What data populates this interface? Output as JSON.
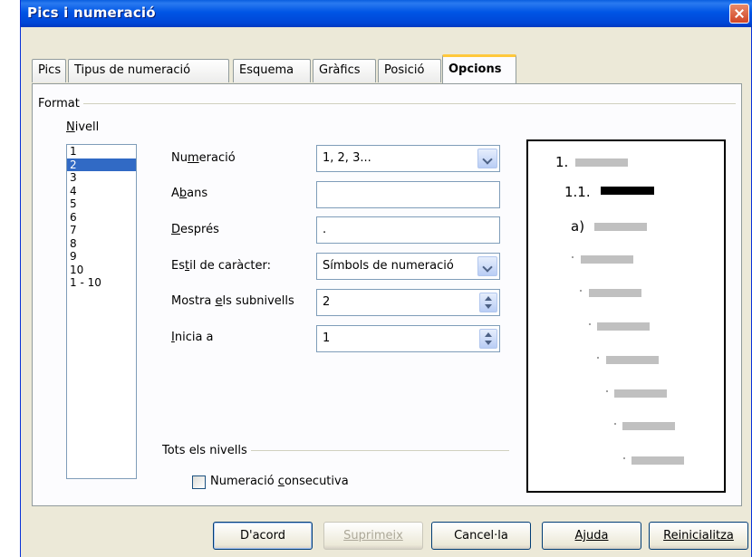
{
  "window": {
    "title": "Pics i numeració"
  },
  "tabs": [
    {
      "label": "Pics"
    },
    {
      "label": "Tipus de numeració"
    },
    {
      "label": "Esquema"
    },
    {
      "label": "Gràfics"
    },
    {
      "label": "Posició"
    },
    {
      "label": "Opcions"
    }
  ],
  "format": {
    "group_label": "Format",
    "level_label_u": "N",
    "level_label_rest": "ivell",
    "levels": [
      "1",
      "2",
      "3",
      "4",
      "5",
      "6",
      "7",
      "8",
      "9",
      "10",
      "1 - 10"
    ],
    "selected_level": "2"
  },
  "fields": {
    "numbering": {
      "label_pre": "Nu",
      "label_u": "m",
      "label_post": "eració",
      "value": "1, 2, 3..."
    },
    "before": {
      "label_pre": "A",
      "label_u": "b",
      "label_post": "ans",
      "value": ""
    },
    "after": {
      "label_pre": "",
      "label_u": "D",
      "label_post": "esprés",
      "value": "."
    },
    "char_style": {
      "label_pre": "Es",
      "label_u": "t",
      "label_post": "il de caràcter:",
      "value": "Símbols de numeració"
    },
    "sublevels": {
      "label_pre": "Mostra ",
      "label_u": "e",
      "label_post": "ls subnivells",
      "value": "2"
    },
    "start_at": {
      "label_pre": "",
      "label_u": "I",
      "label_post": "nicia a",
      "value": "1"
    }
  },
  "all_levels": {
    "group_label": "Tots els nivells",
    "consecutive_pre": "Numeració ",
    "consecutive_u": "c",
    "consecutive_post": "onsecutiva",
    "consecutive_checked": false
  },
  "preview": {
    "line1": "1.",
    "line2": "1.1.",
    "line3": "a)"
  },
  "buttons": {
    "ok": "D'acord",
    "delete": "Suprimeix",
    "cancel": "Cancel·la",
    "help": "Ajuda",
    "reset": "Reinicialitza"
  }
}
